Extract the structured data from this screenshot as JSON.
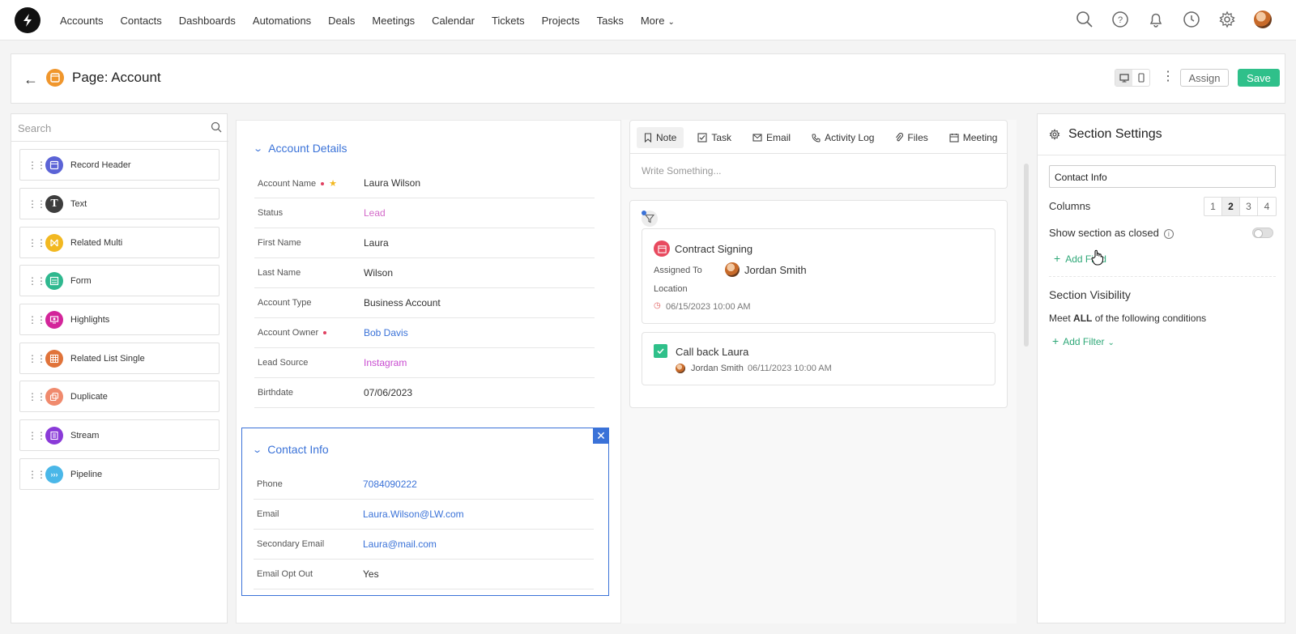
{
  "nav": {
    "links": [
      "Accounts",
      "Contacts",
      "Dashboards",
      "Automations",
      "Deals",
      "Meetings",
      "Calendar",
      "Tickets",
      "Projects",
      "Tasks"
    ],
    "more_label": "More"
  },
  "header": {
    "title": "Page: Account",
    "assign_label": "Assign",
    "save_label": "Save"
  },
  "components": {
    "search_placeholder": "Search",
    "items": [
      {
        "label": "Record Header",
        "color": "#5b63d6"
      },
      {
        "label": "Text",
        "color": "#3d3d3d"
      },
      {
        "label": "Related Multi",
        "color": "#f2b821"
      },
      {
        "label": "Form",
        "color": "#2fb88f"
      },
      {
        "label": "Highlights",
        "color": "#d3259a"
      },
      {
        "label": "Related List Single",
        "color": "#e0733a"
      },
      {
        "label": "Duplicate",
        "color": "#f08a6d"
      },
      {
        "label": "Stream",
        "color": "#8a3ad8"
      },
      {
        "label": "Pipeline",
        "color": "#4ab7e8"
      }
    ]
  },
  "account_details": {
    "title": "Account Details",
    "fields": [
      {
        "label": "Account Name",
        "value": "Laura Wilson"
      },
      {
        "label": "Status",
        "value": "Lead"
      },
      {
        "label": "First Name",
        "value": "Laura"
      },
      {
        "label": "Last Name",
        "value": "Wilson"
      },
      {
        "label": "Account Type",
        "value": "Business Account"
      },
      {
        "label": "Account Owner",
        "value": "Bob Davis"
      },
      {
        "label": "Lead Source",
        "value": "Instagram"
      },
      {
        "label": "Birthdate",
        "value": "07/06/2023"
      }
    ]
  },
  "contact_info": {
    "title": "Contact Info",
    "fields": [
      {
        "label": "Phone",
        "value": "7084090222"
      },
      {
        "label": "Email",
        "value": "Laura.Wilson@LW.com"
      },
      {
        "label": "Secondary Email",
        "value": "Laura@mail.com"
      },
      {
        "label": "Email Opt Out",
        "value": "Yes"
      }
    ]
  },
  "composer": {
    "tabs": [
      "Note",
      "Task",
      "Email",
      "Activity Log",
      "Files",
      "Meeting"
    ],
    "placeholder": "Write Something..."
  },
  "feed": {
    "meeting": {
      "title": "Contract Signing",
      "assigned_label": "Assigned To",
      "assigned_to": "Jordan Smith",
      "location_label": "Location",
      "datetime": "06/15/2023 10:00 AM"
    },
    "task": {
      "title": "Call back Laura",
      "owner": "Jordan Smith",
      "datetime": "06/11/2023 10:00 AM"
    }
  },
  "settings": {
    "title": "Section Settings",
    "section_name": "Contact Info",
    "columns_label": "Columns",
    "columns": [
      "1",
      "2",
      "3",
      "4"
    ],
    "columns_selected": "2",
    "show_closed_label": "Show section as closed",
    "add_field_label": "Add Field",
    "visibility_title": "Section Visibility",
    "meet_prefix": "Meet",
    "meet_bold": "ALL",
    "meet_suffix": "of the following conditions",
    "add_filter_label": "Add Filter"
  }
}
